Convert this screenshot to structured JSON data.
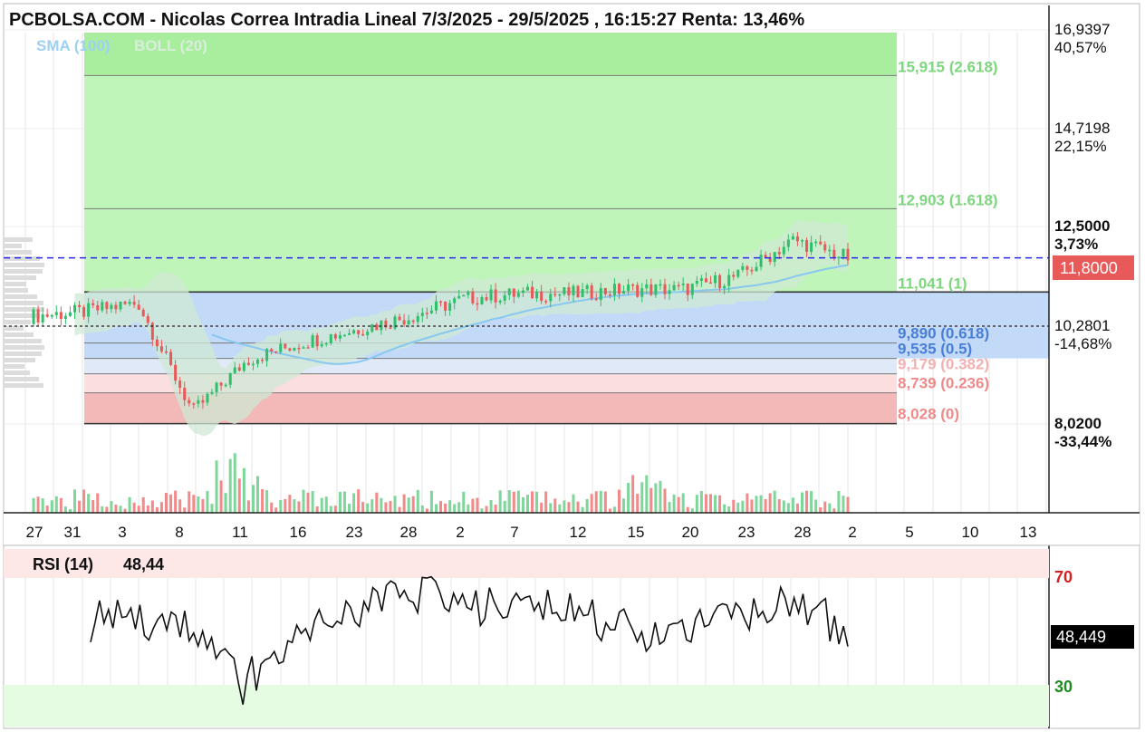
{
  "title": "PCBOLSA.COM - Nicolas Correa Intradia Lineal 7/3/2025 - 29/5/2025 , 16:15:27 Renta: 13,46%",
  "indicators": {
    "sma_label": "SMA (100)",
    "boll_label": "BOLL (20)",
    "sma_color": "#88c8f0",
    "boll_color": "#cfe8d4"
  },
  "price_axis": [
    {
      "price": 16.9397,
      "label": "16,9397",
      "pct": "40,57%",
      "pct_color": "#2a9d6a"
    },
    {
      "price": 14.7198,
      "label": "14,7198",
      "pct": "22,15%",
      "pct_color": "#2a9d6a"
    },
    {
      "price": 12.5,
      "label": "12,5000",
      "pct": "3,73%",
      "pct_color": "#2a9d6a",
      "bold": true
    },
    {
      "price": 10.2801,
      "label": "10,2801",
      "pct": "-14,68%",
      "pct_color": "#e05a5a"
    },
    {
      "price": 8.02,
      "label": "8,0200",
      "pct": "-33,44%",
      "pct_color": "#e05a5a",
      "bold": true
    }
  ],
  "current_price": {
    "value": 11.8,
    "label": "11,8000",
    "color": "#e85a5a"
  },
  "fibonacci": [
    {
      "level": 15.915,
      "label": "15,915 (2.618)",
      "color": "#7ed67e"
    },
    {
      "level": 12.903,
      "label": "12,903 (1.618)",
      "color": "#7ed67e"
    },
    {
      "level": 11.041,
      "label": "11,041 (1)",
      "color": "#7ed67e"
    },
    {
      "level": 9.89,
      "label": "9,890 (0.618)",
      "color": "#4a7fd8"
    },
    {
      "level": 9.535,
      "label": "9,535 (0.5)",
      "color": "#4a7fd8"
    },
    {
      "level": 9.179,
      "label": "9,179 (0.382)",
      "color": "#f4b0b0"
    },
    {
      "level": 8.739,
      "label": "8,739 (0.236)",
      "color": "#f08a8a"
    },
    {
      "level": 8.028,
      "label": "8,028 (0)",
      "color": "#f08a8a"
    }
  ],
  "x_axis_labels": [
    "27",
    "31",
    "3",
    "8",
    "11",
    "16",
    "23",
    "28",
    "2",
    "7",
    "12",
    "15",
    "20",
    "23",
    "28",
    "2",
    "5",
    "10",
    "13"
  ],
  "rsi": {
    "label": "RSI (14)",
    "value": "48,44",
    "value_box": "48,449",
    "levels": [
      {
        "value": 70,
        "label": "70",
        "color": "#d81e1e"
      },
      {
        "value": 30,
        "label": "30",
        "color": "#1f8a1f"
      }
    ]
  },
  "chart_data": {
    "type": "line",
    "title": "PCBOLSA.COM - Nicolas Correa Intradia Lineal 7/3/2025 - 29/5/2025 , 16:15:27 Renta: 13,46%",
    "xlabel": "",
    "ylabel": "",
    "ylim": [
      7.6,
      17.2
    ],
    "grid": true,
    "x": [
      "27",
      "31",
      "3",
      "8",
      "11",
      "16",
      "23",
      "28",
      "2",
      "7",
      "12",
      "15",
      "20",
      "23",
      "28",
      "2"
    ],
    "series": [
      {
        "name": "",
        "values": [
          10.5,
          10.6,
          10.8,
          8.3,
          9.5,
          9.9,
          10.2,
          10.5,
          10.9,
          11.0,
          11.0,
          11.1,
          11.1,
          11.4,
          12.2,
          11.8
        ]
      }
    ],
    "rsi_series": {
      "name": "RSI (14)",
      "values": [
        54,
        54,
        51,
        30,
        46,
        55,
        62,
        64,
        58,
        59,
        54,
        50,
        50,
        57,
        63,
        48.4
      ],
      "ylim": [
        0,
        100
      ]
    }
  }
}
